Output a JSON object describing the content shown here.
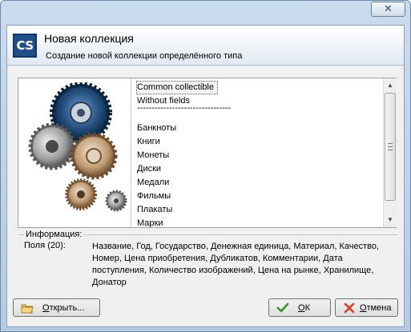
{
  "window": {
    "close_symbol": "✕"
  },
  "header": {
    "logo_text": "CS",
    "title": "Новая коллекция",
    "subtitle": "Создание новой коллекции определённого типа"
  },
  "types": {
    "items": [
      "Common collectible",
      "Without fields",
      "--------------------------------",
      "Банкноты",
      "Книги",
      "Монеты",
      "Диски",
      "Медали",
      "Фильмы",
      "Плакаты",
      "Марки"
    ],
    "selected": "Common collectible"
  },
  "info": {
    "group_title": "Информация:",
    "fields_label": "Поля (20):",
    "fields_text": "Название, Год, Государство, Денежная единица, Материал, Качество, Номер, Цена приобретения, Дубликатов, Комментарии, Дата поступления, Количество изображений, Цена на рынке, Хранилище, Донатор"
  },
  "buttons": {
    "open": {
      "mnemonic": "О",
      "rest": "ткрыть...",
      "icon": "folder-icon"
    },
    "ok": {
      "mnemonic": "О",
      "rest": "К",
      "icon": "checkmark-icon"
    },
    "cancel": {
      "mnemonic": "О",
      "rest": "тмена",
      "icon": "cross-icon"
    }
  },
  "colors": {
    "logo": "#1f4f86",
    "title_bar": "#c9dcef",
    "ok_icon": "#2f9a1f",
    "cancel_icon": "#d3402a"
  }
}
